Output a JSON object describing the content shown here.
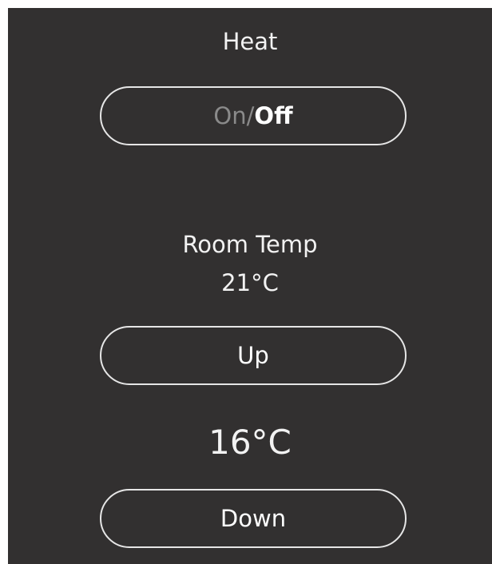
{
  "heat": {
    "title": "Heat",
    "toggle_on": "On",
    "toggle_sep": "/",
    "toggle_off": "Off"
  },
  "room": {
    "label": "Room Temp",
    "value": "21°C"
  },
  "controls": {
    "up_label": "Up",
    "setpoint": "16°C",
    "down_label": "Down"
  },
  "colors": {
    "background": "#323030",
    "text": "#f2f2f2",
    "inactive_text": "#8a8a8a",
    "outline": "#e6e6e6"
  }
}
